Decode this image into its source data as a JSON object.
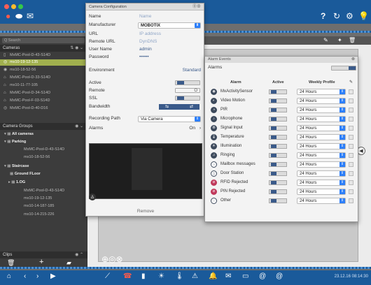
{
  "left_panel": {
    "search_placeholder": "Q Search",
    "cameras_header": "Cameras",
    "cameras": [
      {
        "name": "MxMC-Pool-D-43-S14D",
        "selected": false
      },
      {
        "name": "mx10-19-12-135",
        "selected": true
      },
      {
        "name": "mx10-18-52-56",
        "selected": false
      },
      {
        "name": "MxMC-Pool-D-33-S14D",
        "selected": false
      },
      {
        "name": "mx10-11-77-105",
        "selected": false
      },
      {
        "name": "MxMC-Pool-D-34-S14D",
        "selected": false
      },
      {
        "name": "MxMC-Pool-F-03-S14D",
        "selected": false
      },
      {
        "name": "MxMC-Pool-D-40-D16",
        "selected": false
      }
    ],
    "groups_header": "Camera Groups",
    "groups": [
      {
        "label": "All cameras",
        "level": 0,
        "bold": true
      },
      {
        "label": "Parking",
        "level": 0,
        "bold": true
      },
      {
        "label": "MxMC-Pool-D-43-S14D",
        "level": 1,
        "bold": false
      },
      {
        "label": "mx10-18-52-56",
        "level": 1,
        "bold": false
      },
      {
        "label": "Staircase",
        "level": 0,
        "bold": true
      },
      {
        "label": "Ground FLoor",
        "level": 1,
        "bold": true
      },
      {
        "label": "1.OG",
        "level": 1,
        "bold": true
      },
      {
        "label": "MxMC-Pool-D-43-S14D",
        "level": 2,
        "bold": false
      },
      {
        "label": "mx10-19-12-135",
        "level": 2,
        "bold": false
      },
      {
        "label": "mx10-14-187-185",
        "level": 2,
        "bold": false
      },
      {
        "label": "mx10-14-215-226",
        "level": 2,
        "bold": false
      }
    ],
    "clips_header": "Clips"
  },
  "camera_config": {
    "title": "Camera Configuration",
    "fields": {
      "name_label": "Name",
      "name_value": "Name",
      "manufacturer_label": "Manufacturer",
      "manufacturer_value": "MOBOTIX",
      "url_label": "URL",
      "url_value": "IP address",
      "remote_url_label": "Remote URL",
      "remote_url_value": "DynDNS",
      "user_label": "User Name",
      "user_value": "admin",
      "password_label": "Password",
      "password_value": "••••••",
      "environment_label": "Environment",
      "environment_value": "Standard",
      "active_label": "Active",
      "remote_label": "Remote",
      "remote_value": "O",
      "ssl_label": "SSL",
      "bandwidth_label": "Bandwidth",
      "recording_label": "Recording Path",
      "recording_value": "Via Camera",
      "alarms_label": "Alarms",
      "alarms_value": "On",
      "remove_label": "Remove"
    }
  },
  "alarm_events": {
    "title": "Alarm Events",
    "alarms_label": "Alarms",
    "col_alarm": "Alarm",
    "col_active": "Active",
    "col_profile": "Weekly Profile",
    "rows": [
      {
        "name": "MxActivitySensor",
        "profile": "24 Hours"
      },
      {
        "name": "Video Motion",
        "profile": "24 Hours"
      },
      {
        "name": "PIR",
        "profile": "24 Hours"
      },
      {
        "name": "Microphone",
        "profile": "24 Hours"
      },
      {
        "name": "Signal Input",
        "profile": "24 Hours"
      },
      {
        "name": "Temperature",
        "profile": "24 Hours"
      },
      {
        "name": "Illumination",
        "profile": "24 Hours"
      },
      {
        "name": "Ringing",
        "profile": "24 Hours"
      },
      {
        "name": "Mailbox messages",
        "profile": "24 Hours"
      },
      {
        "name": "Door Station",
        "profile": "24 Hours"
      },
      {
        "name": "RFID Rejected",
        "profile": "24 Hours"
      },
      {
        "name": "PIN Rejected",
        "profile": "24 Hours"
      },
      {
        "name": "Other",
        "profile": "24 Hours"
      }
    ]
  },
  "topbar": {
    "help_label": "?"
  },
  "statusbar": {
    "timestamp": "23.12.16 08:14:30"
  },
  "colors": {
    "toolbar_blue": "#1a5a9a",
    "selection_green": "#a1b04e",
    "accent_blue": "#2d7ff9"
  }
}
